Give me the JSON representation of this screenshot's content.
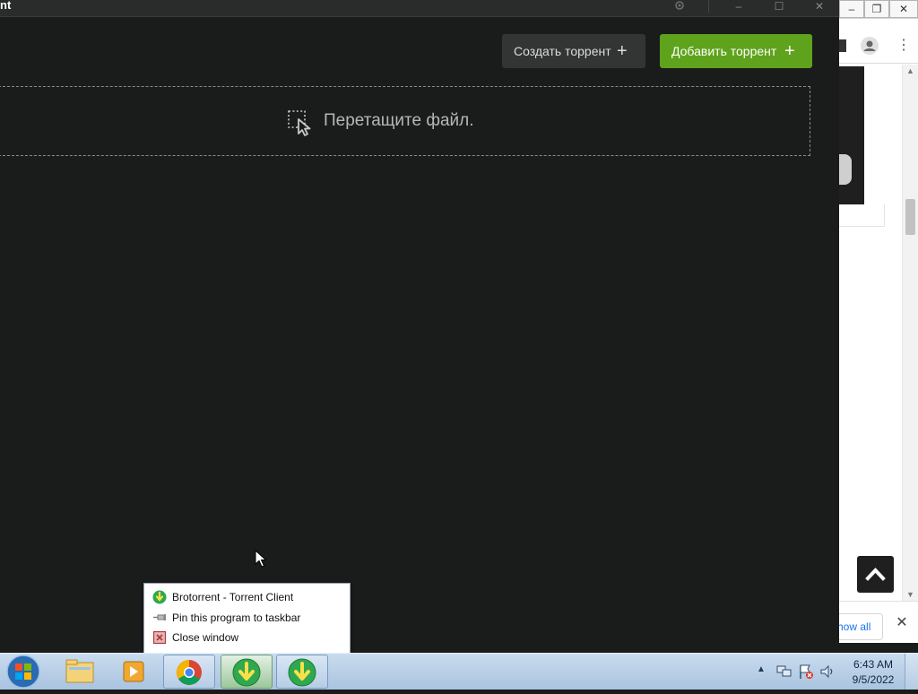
{
  "app": {
    "title_fragment": "nt",
    "create_torrent_label": "Создать торрент",
    "add_torrent_label": "Добавить торрент",
    "dropzone_text": "Перетащите файл."
  },
  "background_browser": {
    "show_all_label": "how all"
  },
  "jumplist": {
    "items": [
      {
        "label": "Brotorrent - Torrent Client",
        "icon": "brotorrent-icon"
      },
      {
        "label": "Pin this program to taskbar",
        "icon": "pin-icon"
      },
      {
        "label": "Close window",
        "icon": "close-window-icon"
      }
    ]
  },
  "taskbar": {
    "time": "6:43 AM",
    "date": "9/5/2022",
    "items": [
      "start-orb",
      "windows-explorer",
      "media-player",
      "chrome",
      "brotorrent",
      "brotorrent"
    ]
  },
  "colors": {
    "app_bg": "#1a1b1b",
    "accent_green": "#5ea31b",
    "create_btn_bg": "#333535"
  }
}
